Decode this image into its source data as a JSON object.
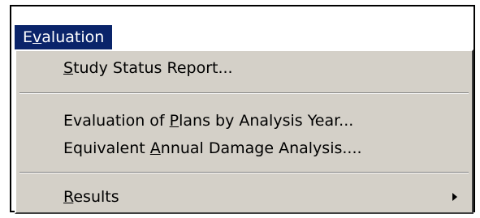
{
  "menu": {
    "title": {
      "pre": "E",
      "key": "v",
      "post": "aluation"
    },
    "items": [
      {
        "pre": "",
        "key": "S",
        "post": "tudy Status Report...",
        "has_submenu": false
      },
      {
        "pre": "Evaluation of ",
        "key": "P",
        "post": "lans by Analysis Year...",
        "has_submenu": false
      },
      {
        "pre": "Equivalent ",
        "key": "A",
        "post": "nnual Damage Analysis....",
        "has_submenu": false
      },
      {
        "pre": "",
        "key": "R",
        "post": "esults",
        "has_submenu": true
      }
    ]
  },
  "colors": {
    "menu_highlight": "#0a246a",
    "menu_background": "#d4d0c8"
  },
  "icons": {
    "submenu": "triangle-right-icon"
  }
}
